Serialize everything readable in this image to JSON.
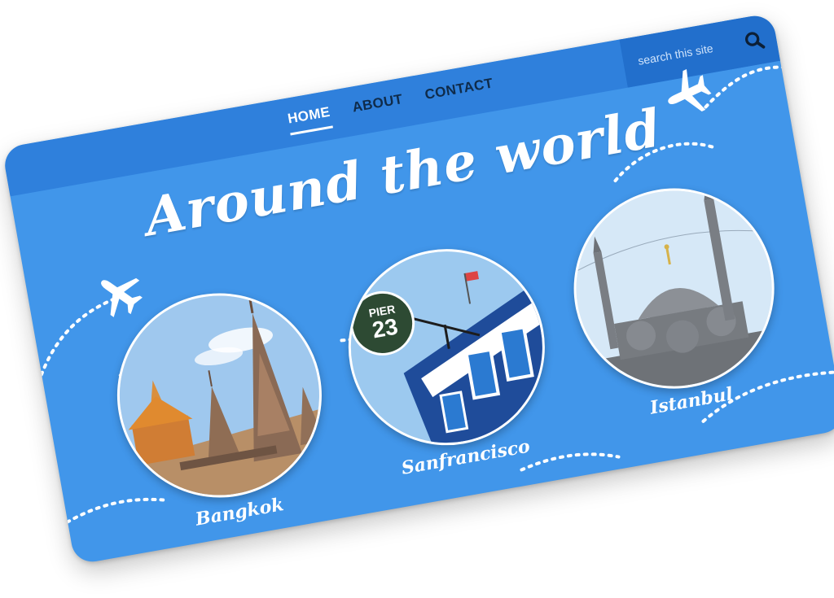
{
  "header": {
    "nav": [
      {
        "label": "HOME",
        "active": true
      },
      {
        "label": "ABOUT",
        "active": false
      },
      {
        "label": "CONTACT",
        "active": false
      }
    ],
    "search": {
      "placeholder": "search this site",
      "icon": "search-icon"
    }
  },
  "hero": {
    "title": "Around the world"
  },
  "destinations": [
    {
      "name": "Bangkok",
      "icon": "temple-photo"
    },
    {
      "name": "Sanfrancisco",
      "icon": "pier-photo",
      "sign": "PIER",
      "sign_number": "23"
    },
    {
      "name": "Istanbul",
      "icon": "mosque-photo"
    }
  ],
  "colors": {
    "card": "#4196ea",
    "topbar": "#2f80dc",
    "search_bg": "#226fcc",
    "nav_text": "#0f2b4a",
    "accent": "#ffffff"
  },
  "decorations": {
    "plane_icon": "airplane-icon",
    "route_line": "dotted-route"
  }
}
